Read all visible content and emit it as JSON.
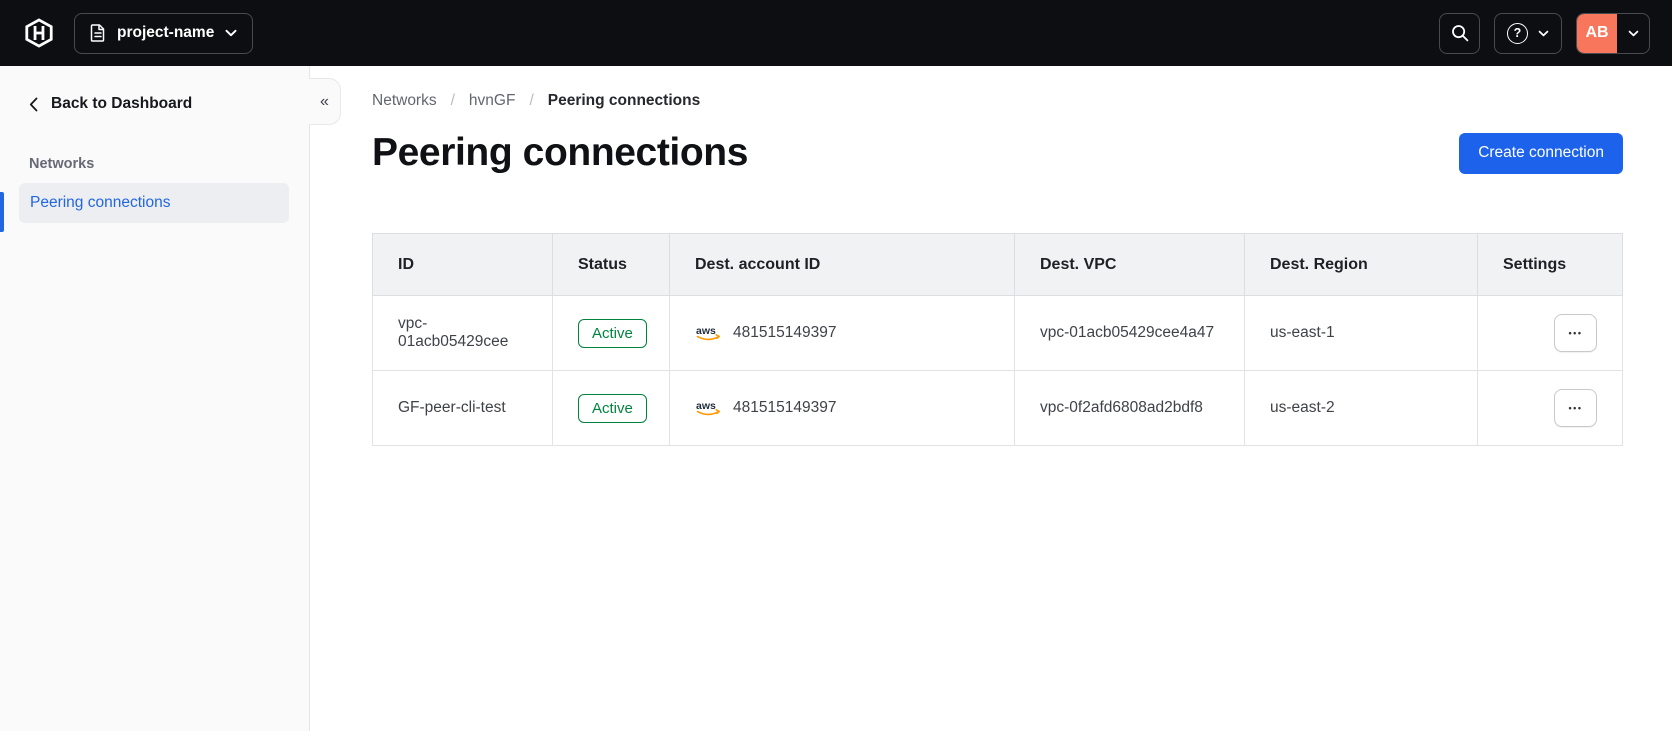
{
  "topbar": {
    "project_label": "project-name",
    "avatar_initials": "AB"
  },
  "sidebar": {
    "back_label": "Back to Dashboard",
    "section_label": "Networks",
    "items": [
      {
        "label": "Peering connections",
        "active": true
      }
    ]
  },
  "breadcrumb": {
    "separator": "/",
    "items": [
      "Networks",
      "hvnGF",
      "Peering connections"
    ]
  },
  "page": {
    "title": "Peering connections",
    "create_button_label": "Create connection"
  },
  "table": {
    "columns": [
      "ID",
      "Status",
      "Dest. account ID",
      "Dest. VPC",
      "Dest. Region",
      "Settings"
    ],
    "rows": [
      {
        "id": "vpc-01acb05429cee",
        "status": "Active",
        "dest_account_id": "481515149397",
        "dest_vpc": "vpc-01acb05429cee4a47",
        "dest_region": "us-east-1"
      },
      {
        "id": "GF-peer-cli-test",
        "status": "Active",
        "dest_account_id": "481515149397",
        "dest_vpc": "vpc-0f2afd6808ad2bdf8",
        "dest_region": "us-east-2"
      }
    ]
  },
  "icons": {
    "collapse": "«",
    "help": "?",
    "ellipsis": "•••",
    "aws_label": "aws"
  },
  "colors": {
    "topbar_bg": "#0D0E12",
    "accent_blue": "#1C62EA",
    "link_blue": "#2266E2",
    "success_green": "#00843D",
    "avatar_salmon": "#F8765B",
    "aws_orange": "#FF9900",
    "sidebar_bg": "#FAFAFA"
  }
}
